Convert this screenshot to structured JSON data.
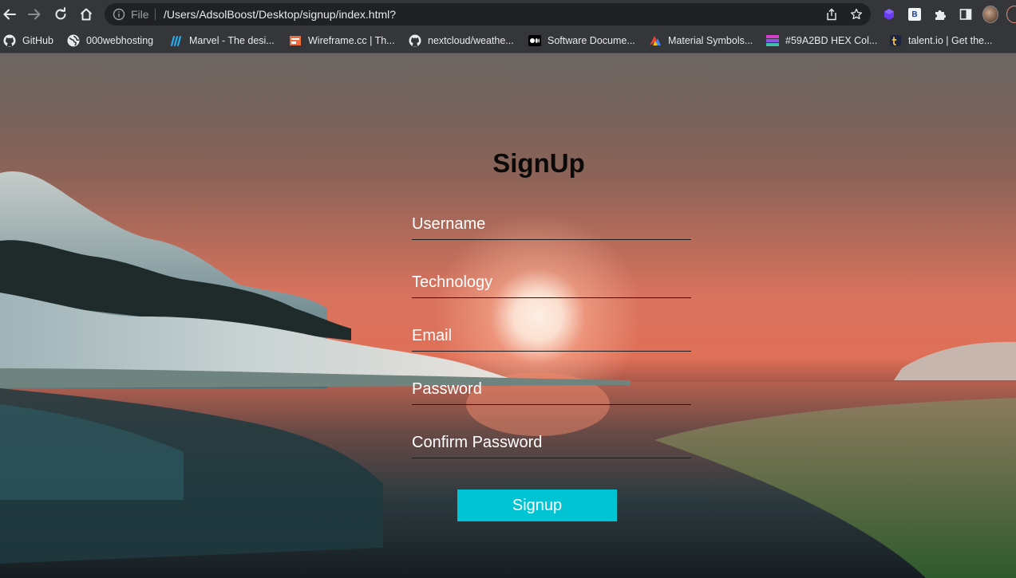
{
  "browser": {
    "url_scheme": "File",
    "url": "/Users/AdsolBoost/Desktop/signup/index.html?",
    "bookmarks": [
      {
        "label": "GitHub",
        "icon": "github-icon"
      },
      {
        "label": "000webhosting",
        "icon": "globe-icon"
      },
      {
        "label": "Marvel - The desi...",
        "icon": "marvel-icon"
      },
      {
        "label": "Wireframe.cc | Th...",
        "icon": "wireframe-icon"
      },
      {
        "label": "nextcloud/weathe...",
        "icon": "github-icon"
      },
      {
        "label": "Software Docume...",
        "icon": "medium-icon"
      },
      {
        "label": "Material Symbols...",
        "icon": "material-icon"
      },
      {
        "label": "#59A2BD HEX Col...",
        "icon": "color-hex-icon"
      },
      {
        "label": "talent.io | Get the...",
        "icon": "talent-icon"
      }
    ],
    "extension_badge": "B"
  },
  "signup": {
    "title": "SignUp",
    "fields": {
      "username": {
        "placeholder": "Username",
        "value": ""
      },
      "technology": {
        "placeholder": "Technology",
        "value": ""
      },
      "email": {
        "placeholder": "Email",
        "value": ""
      },
      "password": {
        "placeholder": "Password",
        "value": ""
      },
      "confirm_password": {
        "placeholder": "Confirm Password",
        "value": ""
      }
    },
    "submit_label": "Signup"
  },
  "colors": {
    "button_bg": "#00c4d4",
    "title": "#0a0a0a",
    "field_text": "#ffffff",
    "chrome_toolbar": "#35363a",
    "omnibox": "#202124"
  }
}
